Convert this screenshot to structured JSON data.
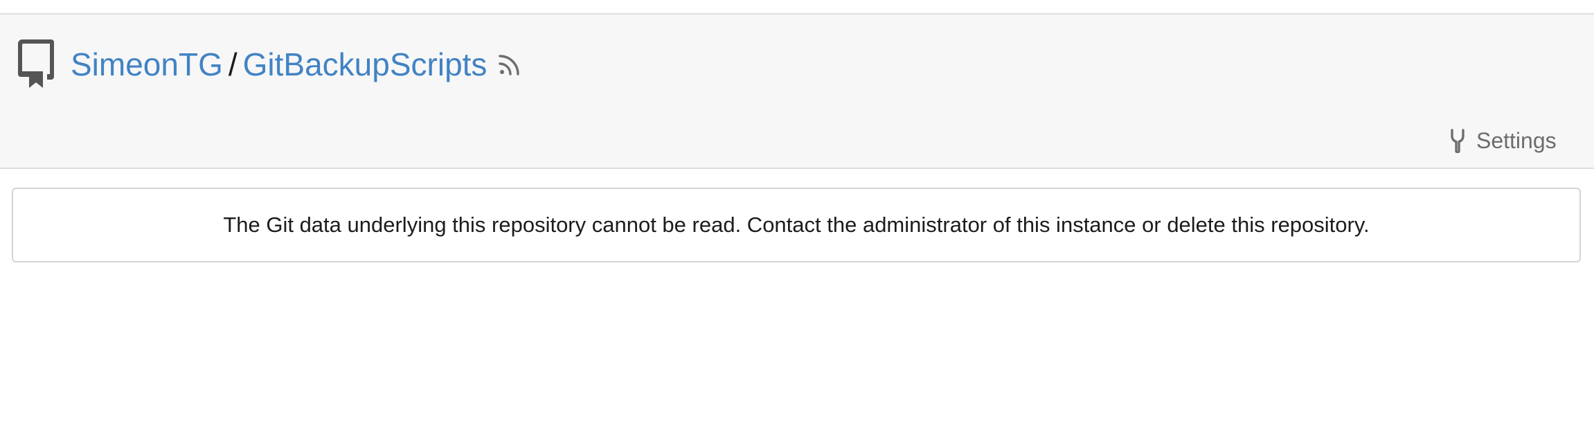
{
  "breadcrumb": {
    "owner": "SimeonTG",
    "separator": "/",
    "repo": "GitBackupScripts"
  },
  "icons": {
    "repo": "repo-icon",
    "rss": "rss-icon",
    "settings": "wrench-icon"
  },
  "tabs": {
    "settings_label": "Settings"
  },
  "message": {
    "text": "The Git data underlying this repository cannot be read. Contact the administrator of this instance or delete this repository."
  },
  "colors": {
    "link": "#4183c4",
    "header_bg": "#f7f7f7",
    "tab_text": "#6d6d6d"
  }
}
